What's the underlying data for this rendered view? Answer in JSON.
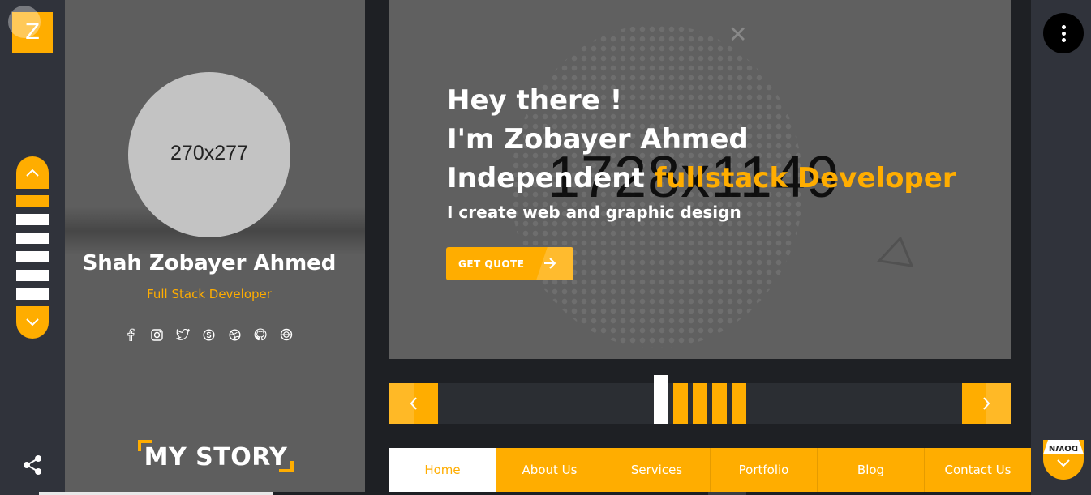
{
  "logo": {
    "letter": "Z"
  },
  "profile": {
    "avatar_placeholder": "270x277",
    "name": "Shah Zobayer Ahmed",
    "role": "Full Stack Developer",
    "socials": [
      "facebook-icon",
      "instagram-icon",
      "twitter-icon",
      "skype-icon",
      "dribbble-icon",
      "github-icon",
      "circle-icon"
    ],
    "story_label": "MY STORY"
  },
  "hero": {
    "placeholder": "1728x1149",
    "line1": "Hey there !",
    "line2": "I'm Zobayer Ahmed",
    "line3_prefix": "Independent ",
    "line3_highlight": "fullstack Developer",
    "subtitle": "I create web and graphic design",
    "quote_button": "GET QUOTE"
  },
  "slider": {
    "total": 5,
    "active_index": 0
  },
  "tabs": [
    {
      "label": "Home",
      "active": true
    },
    {
      "label": "About Us",
      "active": false
    },
    {
      "label": "Services",
      "active": false
    },
    {
      "label": "Portfolio",
      "active": false
    },
    {
      "label": "Blog",
      "active": false
    },
    {
      "label": "Contact Us",
      "active": false
    }
  ],
  "right_rail": {
    "down_label": "DOWN"
  },
  "colors": {
    "accent": "#ffad00",
    "rail": "#30333b",
    "card": "#5e5e5e",
    "hero": "#606060"
  }
}
